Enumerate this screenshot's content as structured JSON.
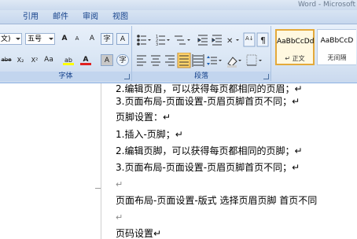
{
  "window": {
    "title": "Word - Microsoft"
  },
  "tabs": {
    "references": "引用",
    "mailings": "邮件",
    "review": "审阅",
    "view": "视图"
  },
  "font_group": {
    "label": "字体",
    "font_name": "文)",
    "font_size": "五号",
    "grow": "A",
    "shrink": "A",
    "clear": "A",
    "phonetic": "字",
    "border": "A",
    "strike": "abe",
    "sub": "X₂",
    "sup": "X²",
    "case": "Aa",
    "highlight": "ab",
    "color": "A",
    "shade": "A",
    "enclose": "字"
  },
  "paragraph_group": {
    "label": "段落"
  },
  "styles_group": {
    "items": [
      {
        "preview": "AaBbCcDd",
        "name": "↵ 正文"
      },
      {
        "preview": "AaBbCcD",
        "name": "无间隔"
      }
    ]
  },
  "document": {
    "lines": [
      "2.编辑页眉，可以获得每页都相同的页眉；↵",
      "3.页面布局-页面设置-页眉页脚首页不同；↵",
      "页脚设置：↵",
      "1.插入-页脚；↵",
      "2.编辑页脚，可以获得每页都相同的页脚；↵",
      "3.页面布局-页面设置-页眉页脚首页不同；↵",
      "↵",
      "页面布局-页面设置-版式   选择页眉页脚  首页不同",
      "↵",
      "页码设置↵"
    ]
  },
  "colors": {
    "ribbon": "#dbe7f5",
    "tabtext": "#15428b",
    "highlight": "#ffff00",
    "fontcolor": "#e02020"
  }
}
